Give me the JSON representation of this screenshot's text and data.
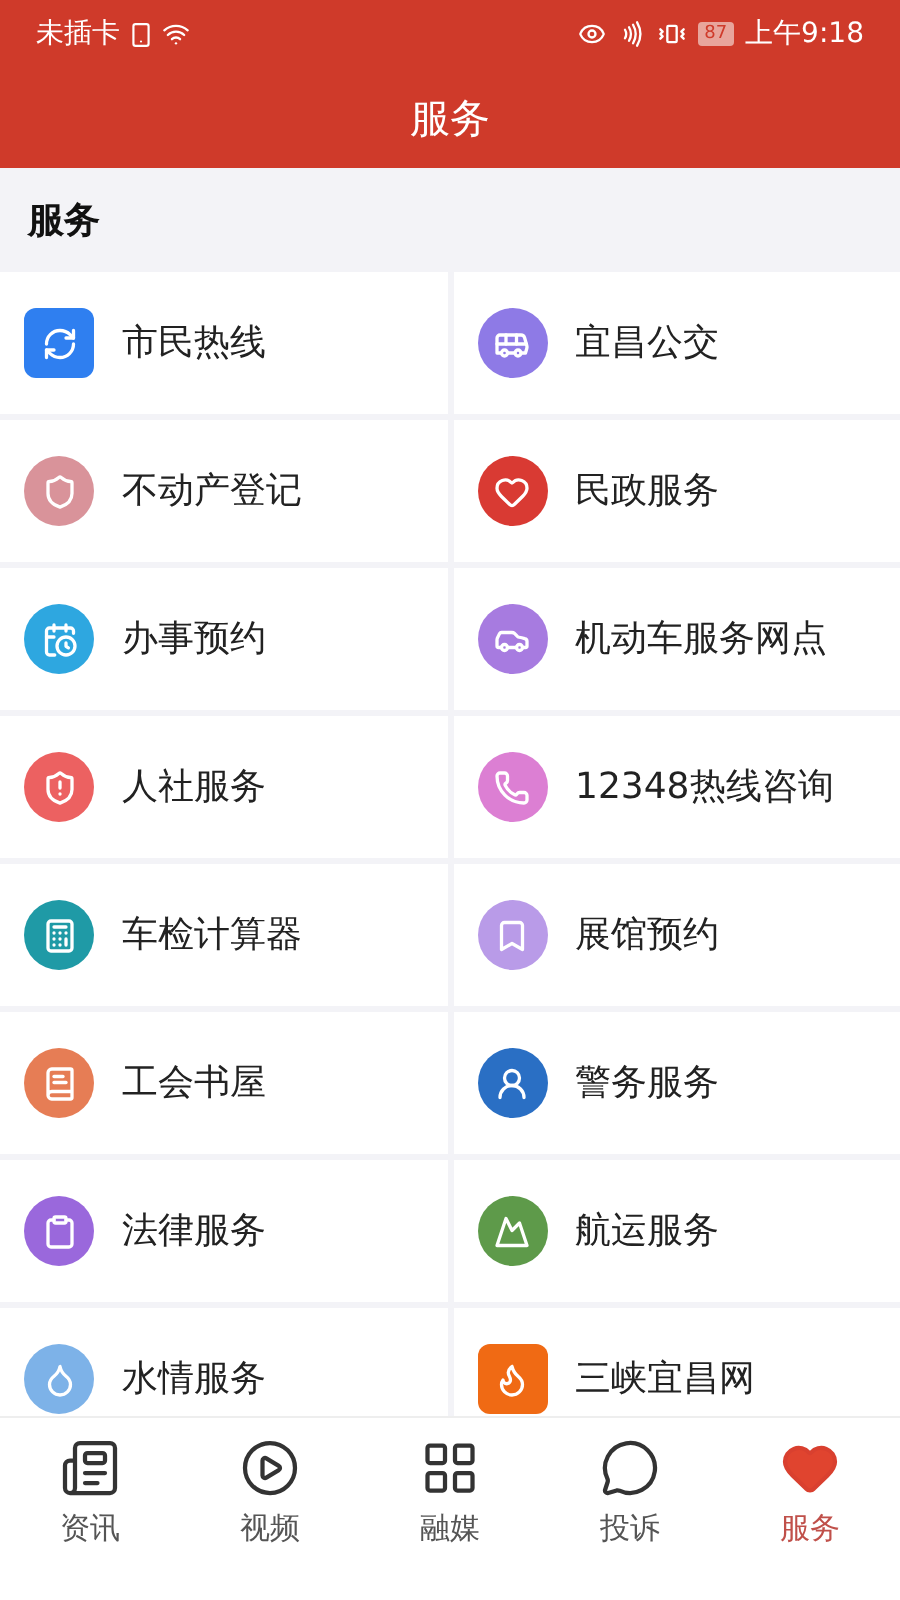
{
  "status_bar": {
    "carrier": "未插卡",
    "battery": "87",
    "time": "上午9:18"
  },
  "header": {
    "title": "服务"
  },
  "section": {
    "title": "服务"
  },
  "services": [
    {
      "label": "市民热线",
      "kind": "square",
      "color": "#2f7ff0"
    },
    {
      "label": "宜昌公交",
      "kind": "circle",
      "color": "#8e7ae6"
    },
    {
      "label": "不动产登记",
      "kind": "circle",
      "color": "#d9939a"
    },
    {
      "label": "民政服务",
      "kind": "circle",
      "color": "#d93a33"
    },
    {
      "label": "办事预约",
      "kind": "circle",
      "color": "#2ea7e0"
    },
    {
      "label": "机动车服务网点",
      "kind": "circle",
      "color": "#a77be0"
    },
    {
      "label": "人社服务",
      "kind": "circle",
      "color": "#ec6161"
    },
    {
      "label": "12348热线咨询",
      "kind": "circle",
      "color": "#dc7fd3"
    },
    {
      "label": "车检计算器",
      "kind": "circle",
      "color": "#1f9aa6"
    },
    {
      "label": "展馆预约",
      "kind": "circle",
      "color": "#b99be8"
    },
    {
      "label": "工会书屋",
      "kind": "circle",
      "color": "#e67d55"
    },
    {
      "label": "警务服务",
      "kind": "circle",
      "color": "#2a6fc4"
    },
    {
      "label": "法律服务",
      "kind": "circle",
      "color": "#9a68dc"
    },
    {
      "label": "航运服务",
      "kind": "circle",
      "color": "#5e9a4a"
    },
    {
      "label": "水情服务",
      "kind": "circle",
      "color": "#7db2e8"
    },
    {
      "label": "三峡宜昌网",
      "kind": "square",
      "color": "#f06a14"
    }
  ],
  "tab_bar": [
    {
      "label": "资讯",
      "selected": false
    },
    {
      "label": "视频",
      "selected": false
    },
    {
      "label": "融媒",
      "selected": false
    },
    {
      "label": "投诉",
      "selected": false
    },
    {
      "label": "服务",
      "selected": true
    }
  ]
}
